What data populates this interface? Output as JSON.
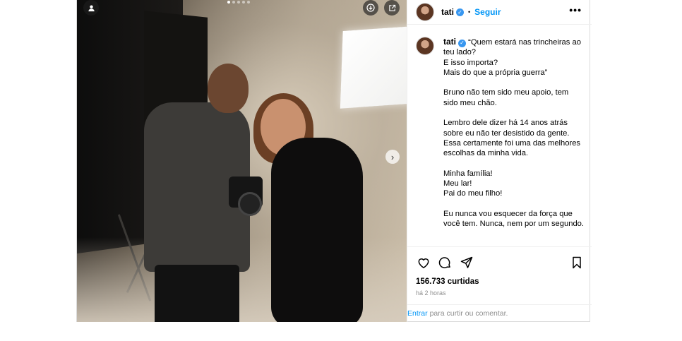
{
  "post": {
    "username": "tati",
    "follow_label": "Seguir",
    "more_label": "•••",
    "separator": "•",
    "carousel": {
      "slides": 5,
      "active": 0
    }
  },
  "caption": {
    "username": "tati",
    "paragraphs": [
      "“Quem estará nas trincheiras ao teu lado?\nE isso importa?\nMais do que a própria guerra”",
      "Bruno não tem sido meu apoio, tem sido meu chão.",
      "Lembro dele dizer há 14 anos atrás sobre eu não ter desistido da gente. Essa certamente foi uma das melhores escolhas da minha vida.",
      "Minha família!\nMeu lar!\nPai do meu filho!",
      "Eu nunca vou esquecer da força que você tem. Nunca, nem por um segundo."
    ]
  },
  "stats": {
    "likes": "156.733 curtidas",
    "time": "há 2 horas"
  },
  "comment_prompt": {
    "login_link": "Entrar",
    "text": "para curtir ou comentar."
  },
  "icons": {
    "tagged_user": "person-icon",
    "save_photo": "download-icon",
    "share_out": "external-link-icon",
    "next": "chevron-right-icon",
    "like": "heart-icon",
    "comment": "comment-icon",
    "share": "paper-plane-icon",
    "save": "bookmark-icon",
    "verified": "verified-badge-icon"
  },
  "colors": {
    "accent": "#0095f6",
    "verified": "#3897f0",
    "muted": "#8e8e8e",
    "border": "#dbdbdb"
  }
}
